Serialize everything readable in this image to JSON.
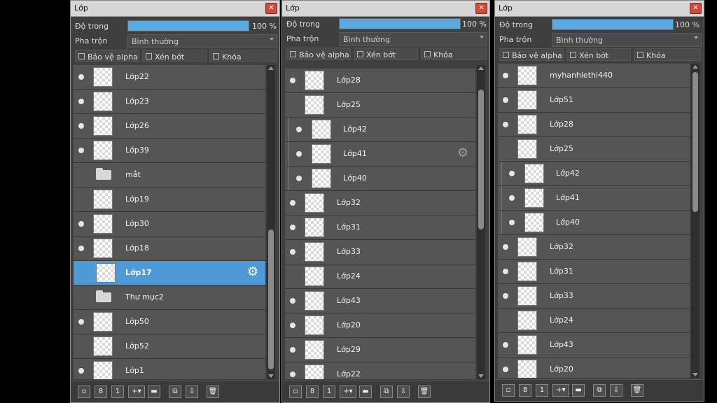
{
  "panels": [
    {
      "title": "Lớp",
      "opacity_label": "Độ trong",
      "opacity_value": "100 %",
      "opacity_fraction": 1.0,
      "blend_label": "Pha trộn",
      "blend_value": "Bình thường",
      "checks": [
        "Bảo vệ alpha",
        "Xén bớt",
        "Khóa"
      ],
      "layers": [
        {
          "name": "Lớp22",
          "visible": true
        },
        {
          "name": "Lớp23",
          "visible": true
        },
        {
          "name": "Lớp26",
          "visible": true
        },
        {
          "name": "Lớp39",
          "visible": true
        },
        {
          "name": "mắt",
          "visible": true,
          "folder": true
        },
        {
          "name": "Lớp19",
          "visible": false
        },
        {
          "name": "Lớp30",
          "visible": true
        },
        {
          "name": "Lớp18",
          "visible": true
        },
        {
          "name": "Lớp17",
          "visible": false,
          "selected": true
        },
        {
          "name": "Thư mục2",
          "visible": false,
          "folder": true
        },
        {
          "name": "Lớp50",
          "visible": true
        },
        {
          "name": "Lớp52",
          "visible": false
        },
        {
          "name": "Lớp1",
          "visible": true
        }
      ]
    },
    {
      "title": "Lớp",
      "opacity_label": "Độ trong",
      "opacity_value": "100 %",
      "opacity_fraction": 1.0,
      "blend_label": "Pha trộn",
      "blend_value": "Bình thường",
      "checks": [
        "Bảo vệ alpha",
        "Xén bớt",
        "Khóa"
      ],
      "layers": [
        {
          "name": "Lớp28",
          "visible": true
        },
        {
          "name": "Lớp25",
          "visible": false
        },
        {
          "name": "Lớp42",
          "visible": true,
          "sub": true
        },
        {
          "name": "Lớp41",
          "visible": true,
          "sub": true,
          "gear": true
        },
        {
          "name": "Lớp40",
          "visible": true,
          "sub": true
        },
        {
          "name": "Lớp32",
          "visible": true
        },
        {
          "name": "Lớp31",
          "visible": true
        },
        {
          "name": "Lớp33",
          "visible": true
        },
        {
          "name": "Lớp24",
          "visible": false
        },
        {
          "name": "Lớp43",
          "visible": true
        },
        {
          "name": "Lớp20",
          "visible": true
        },
        {
          "name": "Lớp29",
          "visible": true
        },
        {
          "name": "Lớp22",
          "visible": true
        }
      ]
    },
    {
      "title": "Lớp",
      "opacity_label": "Độ trong",
      "opacity_value": "100 %",
      "opacity_fraction": 1.0,
      "blend_label": "Pha trộn",
      "blend_value": "Bình thường",
      "checks": [
        "Bảo vệ alpha",
        "Xén bớt",
        "Khóa"
      ],
      "layers": [
        {
          "name": "myhanhlethi440",
          "visible": true
        },
        {
          "name": "Lớp51",
          "visible": true
        },
        {
          "name": "Lớp28",
          "visible": true
        },
        {
          "name": "Lớp25",
          "visible": false
        },
        {
          "name": "Lớp42",
          "visible": true,
          "sub": true
        },
        {
          "name": "Lớp41",
          "visible": true,
          "sub": true
        },
        {
          "name": "Lớp40",
          "visible": true,
          "sub": true
        },
        {
          "name": "Lớp32",
          "visible": true
        },
        {
          "name": "Lớp31",
          "visible": true
        },
        {
          "name": "Lớp33",
          "visible": true
        },
        {
          "name": "Lớp24",
          "visible": false
        },
        {
          "name": "Lớp43",
          "visible": true
        },
        {
          "name": "Lớp20",
          "visible": true
        }
      ]
    }
  ],
  "colors": {
    "accent": "#4f9ad6",
    "panel_bg": "#3f3f3f",
    "row_bg": "#555555",
    "close": "#d24b3a"
  },
  "toolbar_icons": [
    "new-layer-icon",
    "new-layer-8bit-icon",
    "new-layer-1bit-icon",
    "add-layer-dropdown-icon",
    "new-folder-icon",
    "duplicate-layer-icon",
    "merge-down-icon",
    "delete-layer-icon"
  ]
}
